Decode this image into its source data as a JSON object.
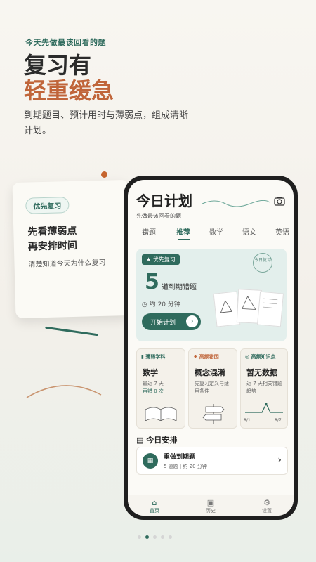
{
  "intro": {
    "eyebrow": "今天先做最该回看的题",
    "headline_line1": "复习有",
    "headline_line2": "轻重缓急",
    "description": "到期题目、预计用时与薄弱点，组成清晰计划。"
  },
  "float_card": {
    "pill": "优先复习",
    "title_line1": "先看薄弱点",
    "title_line2": "再安排时间",
    "subtitle": "清楚知道今天为什么复习"
  },
  "app": {
    "title": "今日计划",
    "subtitle": "先做最该回看的题",
    "tabs": [
      "错题",
      "推荐",
      "数学",
      "语文",
      "英语"
    ],
    "active_tab": "推荐",
    "hero": {
      "badge": "优先复习",
      "count": "5",
      "count_label": "道到期错题",
      "time": "约 20 分钟",
      "button": "开始计划",
      "stamp": "今日复习"
    },
    "cards": [
      {
        "tag": "薄弱学科",
        "headline": "数学",
        "line1": "最近 7 天",
        "line2": "再错 0 次"
      },
      {
        "tag": "高频错因",
        "headline": "概念混淆",
        "line1": "先复习定义与适",
        "line2": "用条件"
      },
      {
        "tag": "高频知识点",
        "headline": "暂无数据",
        "line1": "近 7 天相关错题",
        "line2": "趋势",
        "x_start": "8/1",
        "x_end": "8/7"
      }
    ],
    "schedule": {
      "title": "今日安排",
      "item_title": "重做到期题",
      "item_sub": "5 道题 | 约 20 分钟"
    },
    "nav": [
      "首页",
      "历史",
      "设置"
    ]
  },
  "colors": {
    "accent": "#2f6b5d",
    "orange": "#c0653a"
  }
}
